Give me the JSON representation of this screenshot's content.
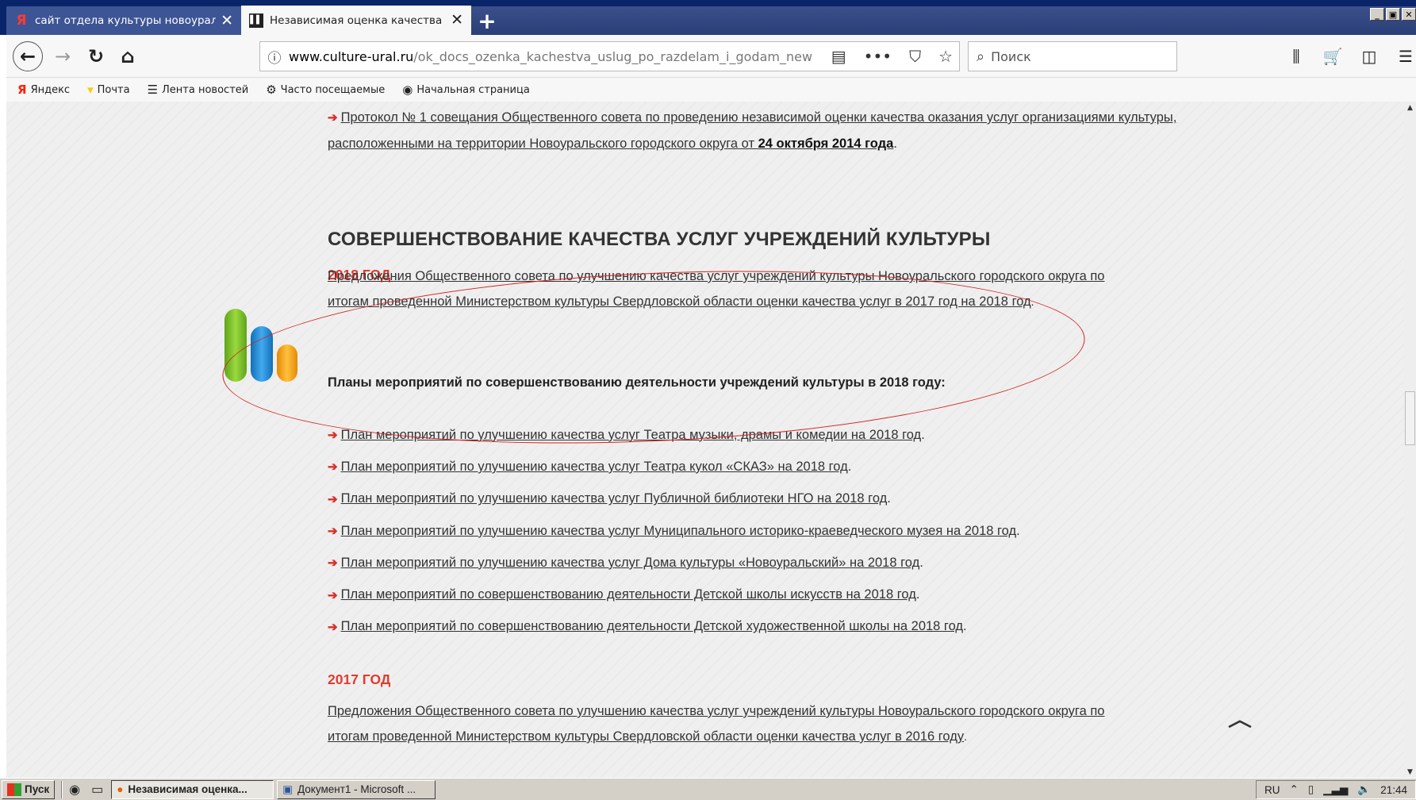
{
  "tabs": [
    {
      "favicon": "Я",
      "title": "сайт отдела культуры новоурал",
      "close": "✕"
    },
    {
      "favicon": "▌▌",
      "title": "Независимая оценка качества у",
      "close": "✕"
    }
  ],
  "new_tab": "+",
  "window_buttons": [
    "_",
    "▣",
    "✕"
  ],
  "nav": {
    "url_domain": "www.culture-ural.ru",
    "url_path": "/ok_docs_ozenka_kachestva_uslug_po_razdelam_i_godam_new",
    "search_placeholder": "Поиск"
  },
  "bookmarks": [
    {
      "icon": "Я",
      "label": "Яндекс"
    },
    {
      "icon": "▾",
      "label": "Почта"
    },
    {
      "icon": "☰",
      "label": "Лента новостей"
    },
    {
      "icon": "⚙",
      "label": "Часто посещаемые"
    },
    {
      "icon": "◉",
      "label": "Начальная страница"
    }
  ],
  "content": {
    "protocol_text": "Протокол № 1 совещания Общественного совета по проведению независимой оценки качества оказания услуг организациями культуры, расположенными на территории Новоуральского городского округа от ",
    "protocol_date": "24 октября 2014 года",
    "heading": "СОВЕРШЕНСТВОВАНИЕ КАЧЕСТВА УСЛУГ УЧРЕЖДЕНИЙ КУЛЬТУРЫ",
    "year_2018": "2018 ГОД",
    "proposal_2018_line1": "Предложения Общественного совета по улучшению качества услуг учреждений культуры Новоуральского городского округа по",
    "proposal_2018_line2": "итогам проведенной Министерством культуры Свердловской области оценки качества услуг в 2017 год на 2018 год",
    "plans_heading": "Планы мероприятий по совершенствованию деятельности учреждений культуры в 2018 году:",
    "plans": [
      "План мероприятий по улучшению качества услуг Театра музыки, драмы и комедии на 2018 год",
      "План мероприятий по улучшению качества услуг Театра кукол «СКАЗ» на 2018 год",
      "План мероприятий по улучшению качества услуг Публичной библиотеки НГО на 2018 год",
      "План мероприятий по улучшению качества услуг Муниципального историко-краеведческого музея на 2018 год",
      "План мероприятий по улучшению качества услуг Дома культуры «Новоуральский» на 2018 год",
      "План мероприятий по совершенствованию деятельности Детской школы искусств на 2018 год",
      "План мероприятий по совершенствованию деятельности Детской художественной школы на 2018 год"
    ],
    "year_2017": "2017 ГОД",
    "proposal_2017_line1": "Предложения Общественного совета по улучшению качества услуг учреждений культуры Новоуральского городского округа по",
    "proposal_2017_line2": "итогам проведенной Министерством культуры Свердловской области оценки качества услуг в 2016 году"
  },
  "taskbar": {
    "start": "Пуск",
    "tasks": [
      "Независимая оценка...",
      "Документ1 - Microsoft ..."
    ],
    "lang": "RU",
    "time": "21:44"
  },
  "colors": {
    "accent_red": "#e03c31",
    "logo_green": "#7cc22a",
    "logo_blue": "#1e8fd6",
    "logo_orange": "#f6a11b",
    "annotation_ellipse": "#d72222"
  }
}
